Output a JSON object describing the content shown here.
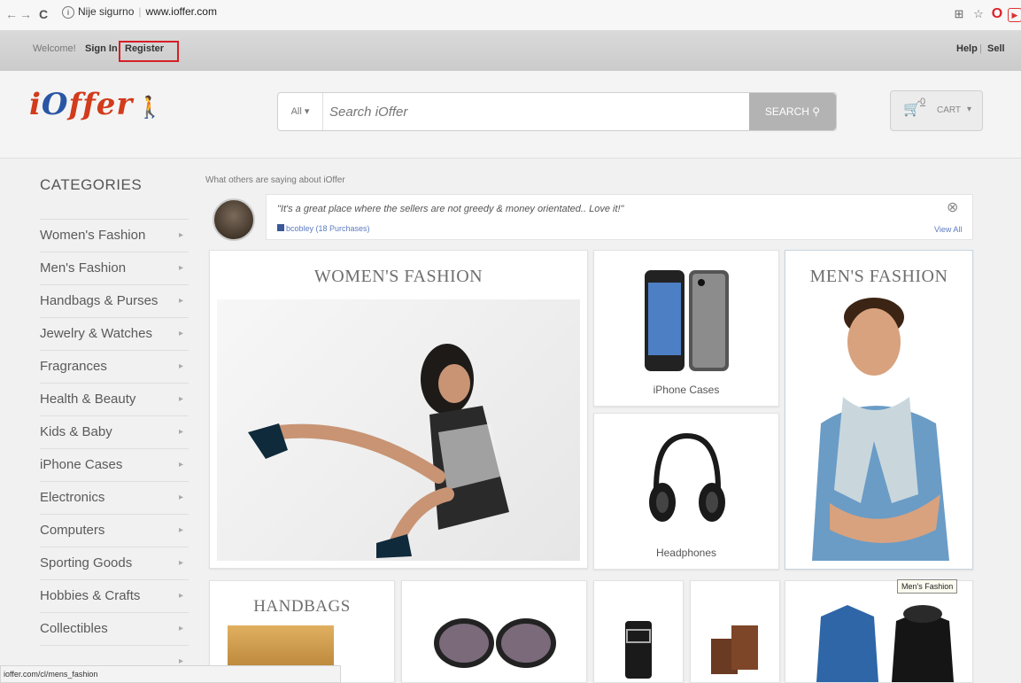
{
  "browser": {
    "nav_back": "←",
    "nav_forward": "→",
    "reload": "C",
    "security_label": "Nije sigurno",
    "url": "www.ioffer.com"
  },
  "userbar": {
    "welcome": "Welcome!",
    "sign_in": "Sign In",
    "register": "Register",
    "help": "Help",
    "sell": "Sell"
  },
  "header": {
    "logo_i": "i",
    "logo_o": "O",
    "logo_rest": "ffer",
    "search_category": "All",
    "search_placeholder": "Search iOffer",
    "search_button": "SEARCH",
    "cart_count": "0",
    "cart_label": "CART"
  },
  "categories": {
    "title": "CATEGORIES",
    "items": [
      "Women's Fashion",
      "Men's Fashion",
      "Handbags & Purses",
      "Jewelry & Watches",
      "Fragrances",
      "Health & Beauty",
      "Kids & Baby",
      "iPhone Cases",
      "Electronics",
      "Computers",
      "Sporting Goods",
      "Hobbies & Crafts",
      "Collectibles"
    ]
  },
  "testimonial": {
    "label": "What others are saying about iOffer",
    "quote": "\"It's a great place where the sellers are not greedy & money orientated.. Love it!\"",
    "author": "bcobley (18 Purchases)",
    "view_all": "View All"
  },
  "tiles": {
    "womens_title": "WOMEN'S FASHION",
    "iphone_caption": "iPhone Cases",
    "headphones_caption": "Headphones",
    "mens_title": "MEN'S FASHION",
    "handbags_title": "HANDBAGS"
  },
  "status_url": "ioffer.com/cl/mens_fashion",
  "tooltip": "Men's Fashion",
  "colors": {
    "register_highlight": "#d51f26",
    "logo_red": "#d23b1b",
    "logo_blue": "#2a56a4"
  }
}
